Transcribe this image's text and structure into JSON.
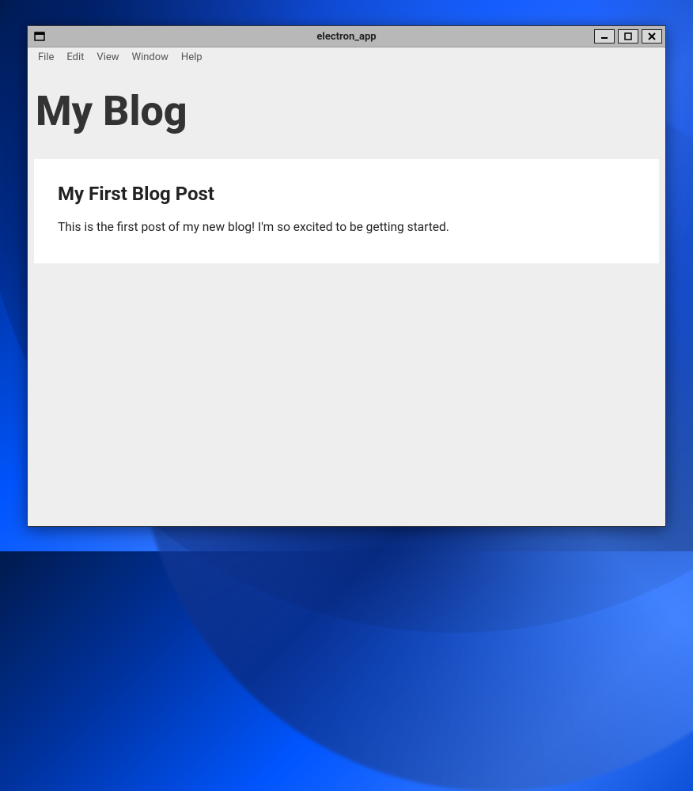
{
  "window": {
    "title": "electron_app"
  },
  "menubar": {
    "items": [
      {
        "label": "File"
      },
      {
        "label": "Edit"
      },
      {
        "label": "View"
      },
      {
        "label": "Window"
      },
      {
        "label": "Help"
      }
    ]
  },
  "page": {
    "title": "My Blog"
  },
  "posts": [
    {
      "title": "My First Blog Post",
      "body": "This is the first post of my new blog! I'm so excited to be getting started."
    }
  ]
}
